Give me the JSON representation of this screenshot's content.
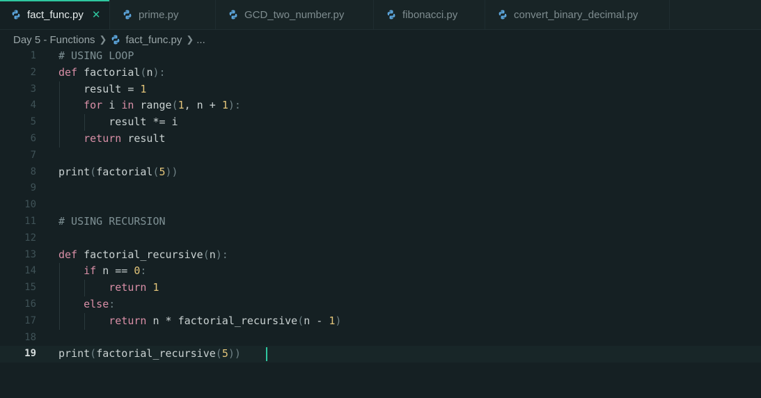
{
  "tabs": [
    {
      "label": "fact_func.py",
      "active": true,
      "closable": true
    },
    {
      "label": "prime.py",
      "active": false
    },
    {
      "label": "GCD_two_number.py",
      "active": false
    },
    {
      "label": "fibonacci.py",
      "active": false
    },
    {
      "label": "convert_binary_decimal.py",
      "active": false
    }
  ],
  "close_glyph": "✕",
  "breadcrumb": {
    "folder": "Day 5 - Functions",
    "file": "fact_func.py",
    "more": "..."
  },
  "editor": {
    "current_line": 19,
    "lines": [
      [
        [
          "cm",
          "# USING LOOP"
        ]
      ],
      [
        [
          "kw",
          "def "
        ],
        [
          "fn",
          "factorial"
        ],
        [
          "pu",
          "("
        ],
        [
          "op",
          "n"
        ],
        [
          "pu",
          "):"
        ]
      ],
      [
        [
          "op",
          "    result = "
        ],
        [
          "num",
          "1"
        ]
      ],
      [
        [
          "kw",
          "    for "
        ],
        [
          "op",
          "i "
        ],
        [
          "kw",
          "in "
        ],
        [
          "fn",
          "range"
        ],
        [
          "pu",
          "("
        ],
        [
          "num",
          "1"
        ],
        [
          "op",
          ", n + "
        ],
        [
          "num",
          "1"
        ],
        [
          "pu",
          "):"
        ]
      ],
      [
        [
          "op",
          "        result *= i"
        ]
      ],
      [
        [
          "kw",
          "    return "
        ],
        [
          "op",
          "result"
        ]
      ],
      [],
      [
        [
          "fn",
          "print"
        ],
        [
          "pu",
          "("
        ],
        [
          "fn",
          "factorial"
        ],
        [
          "pu",
          "("
        ],
        [
          "num",
          "5"
        ],
        [
          "pu",
          "))"
        ]
      ],
      [],
      [],
      [
        [
          "cm",
          "# USING RECURSION"
        ]
      ],
      [],
      [
        [
          "kw",
          "def "
        ],
        [
          "fn",
          "factorial_recursive"
        ],
        [
          "pu",
          "("
        ],
        [
          "op",
          "n"
        ],
        [
          "pu",
          "):"
        ]
      ],
      [
        [
          "kw",
          "    if "
        ],
        [
          "op",
          "n == "
        ],
        [
          "num",
          "0"
        ],
        [
          "pu",
          ":"
        ]
      ],
      [
        [
          "kw",
          "        return "
        ],
        [
          "num",
          "1"
        ]
      ],
      [
        [
          "kw",
          "    else"
        ],
        [
          "pu",
          ":"
        ]
      ],
      [
        [
          "kw",
          "        return "
        ],
        [
          "op",
          "n * "
        ],
        [
          "fn",
          "factorial_recursive"
        ],
        [
          "pu",
          "("
        ],
        [
          "op",
          "n - "
        ],
        [
          "num",
          "1"
        ],
        [
          "pu",
          ")"
        ]
      ],
      [],
      [
        [
          "fn",
          "print"
        ],
        [
          "pu",
          "("
        ],
        [
          "fn",
          "factorial_recursive"
        ],
        [
          "pu",
          "("
        ],
        [
          "num",
          "5"
        ],
        [
          "pu",
          "))"
        ]
      ]
    ]
  },
  "colors": {
    "accent": "#2fc7a0",
    "background": "#152023",
    "keyword": "#d98fa7",
    "number": "#e3c57a",
    "comment": "#7e9094"
  },
  "icons": {
    "file_type": "python-icon",
    "close": "close-icon",
    "chevron": "chevron-right-icon"
  }
}
